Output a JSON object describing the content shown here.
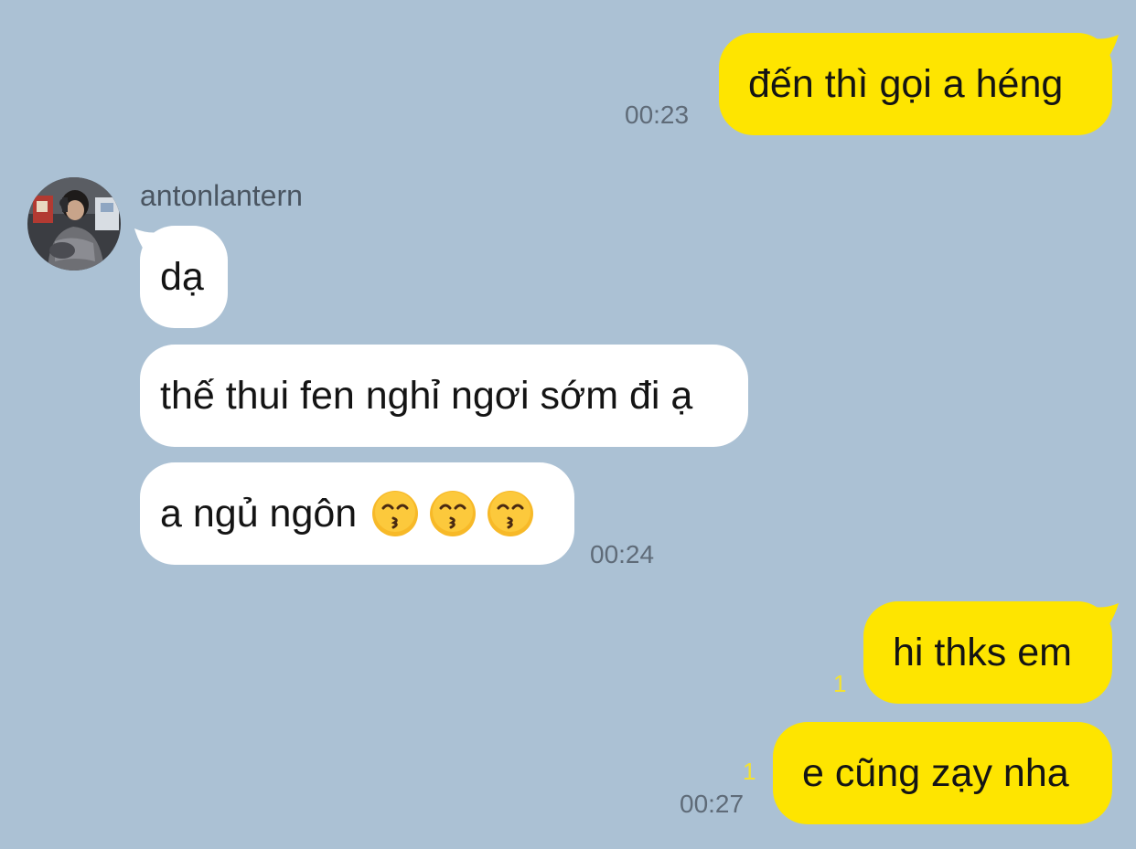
{
  "theme": {
    "background": "#abc1d4",
    "my_bubble": "#fee500",
    "their_bubble": "#ffffff",
    "unread_color": "#f5e22e"
  },
  "chat": {
    "contact": {
      "name": "antonlantern",
      "avatar_icon": "profile-photo"
    },
    "messages": [
      {
        "sender": "me",
        "text": "đến thì gọi a héng",
        "time": "00:23",
        "unread": ""
      },
      {
        "sender": "them",
        "text": "dạ",
        "time": "",
        "unread": ""
      },
      {
        "sender": "them",
        "text": "thế thui fen nghỉ ngơi sớm đi ạ",
        "time": "",
        "unread": ""
      },
      {
        "sender": "them",
        "text": "a ngủ ngôn",
        "emoji": [
          "kissing-face-with-smiling-eyes",
          "kissing-face-with-smiling-eyes",
          "kissing-face-with-smiling-eyes"
        ],
        "time": "00:24",
        "unread": ""
      },
      {
        "sender": "me",
        "text": "hi thks em",
        "time": "",
        "unread": "1"
      },
      {
        "sender": "me",
        "text": "e cũng zạy nha",
        "time": "00:27",
        "unread": "1"
      }
    ]
  }
}
